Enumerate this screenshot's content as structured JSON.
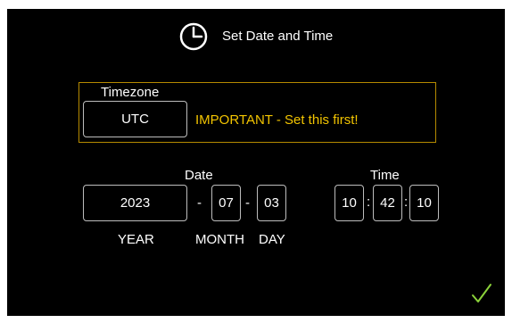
{
  "header": {
    "title": "Set Date and Time",
    "icon": "clock-icon"
  },
  "timezone": {
    "section_label": "Timezone",
    "value": "UTC",
    "warning": "IMPORTANT - Set this first!",
    "warning_color": "#f2c400",
    "frame_color": "#b58a00"
  },
  "date": {
    "section_label": "Date",
    "year": "2023",
    "month": "07",
    "day": "03",
    "separator": "-",
    "year_label": "YEAR",
    "month_label": "MONTH",
    "day_label": "DAY"
  },
  "time": {
    "section_label": "Time",
    "hour": "10",
    "minute": "42",
    "second": "10",
    "separator": ":"
  },
  "confirm": {
    "icon": "checkmark-icon",
    "color": "#8bd23a"
  }
}
